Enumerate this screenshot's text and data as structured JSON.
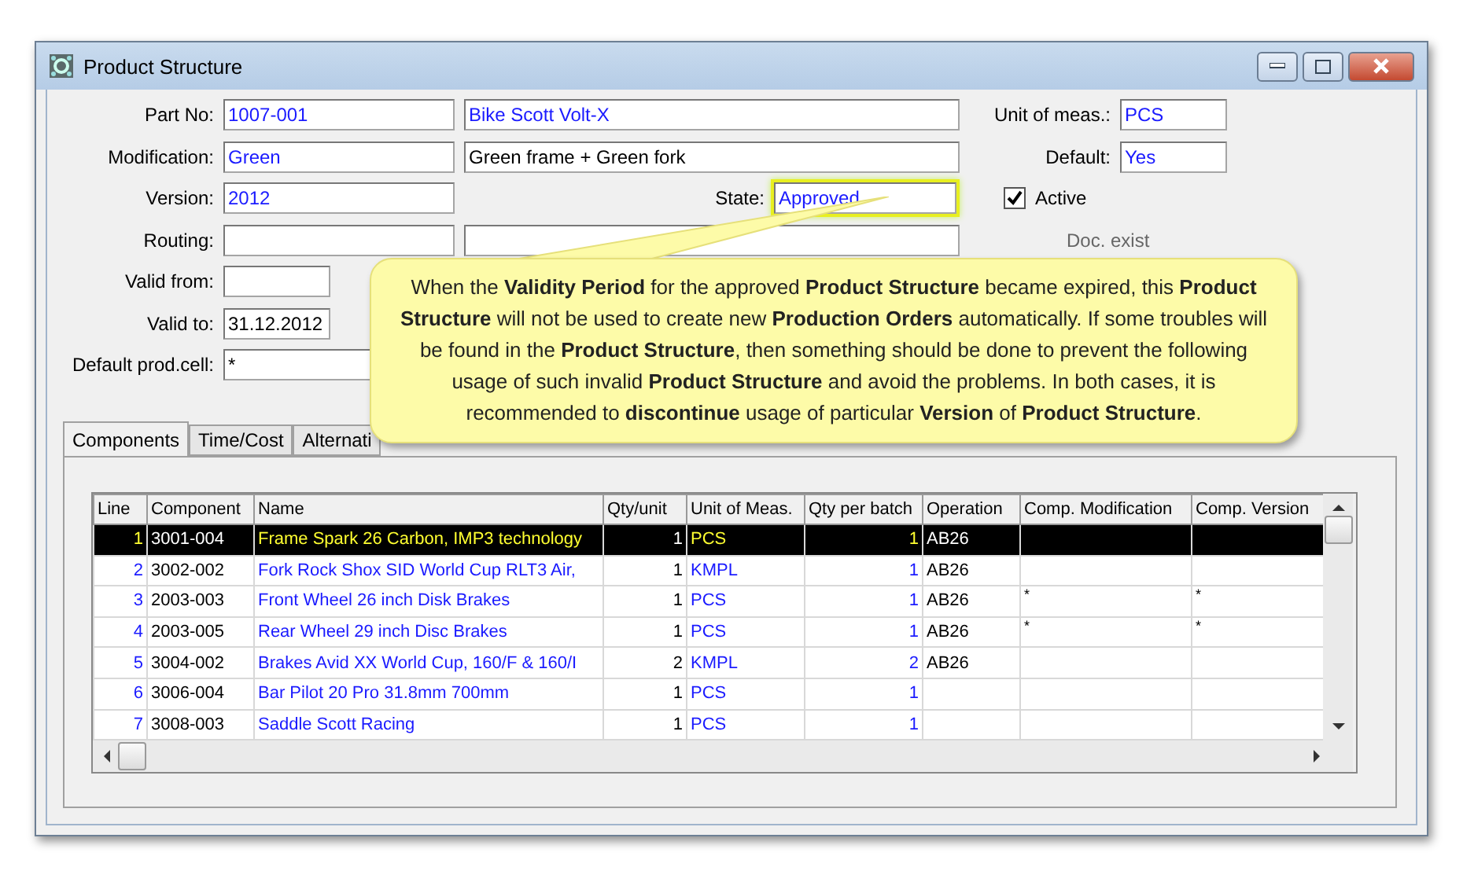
{
  "window": {
    "title": "Product Structure"
  },
  "form": {
    "part_no": {
      "label": "Part No:",
      "value": "1007-001",
      "description": "Bike Scott Volt-X"
    },
    "modification": {
      "label": "Modification:",
      "value": "Green",
      "description": "Green frame + Green fork"
    },
    "version": {
      "label": "Version:",
      "value": "2012"
    },
    "state": {
      "label": "State:",
      "value": "Approved",
      "highlighted": true
    },
    "routing": {
      "label": "Routing:"
    },
    "valid_from": {
      "label": "Valid from:"
    },
    "valid_to": {
      "label": "Valid to:",
      "value": "31.12.2012"
    },
    "default_prod_cell": {
      "label": "Default prod.cell:",
      "value": "*"
    },
    "unit_of_meas": {
      "label": "Unit of meas.:",
      "value": "PCS"
    },
    "default": {
      "label": "Default:",
      "value": "Yes"
    },
    "active": {
      "label": "Active",
      "checked": true
    },
    "doc_exist": {
      "label": "Doc. exist"
    }
  },
  "tabs": [
    {
      "label": "Components",
      "selected": true
    },
    {
      "label": "Time/Cost",
      "selected": false
    },
    {
      "label": "Alternati",
      "selected": false
    }
  ],
  "table": {
    "columns": [
      "Line",
      "Component",
      "Name",
      "Qty/unit",
      "Unit of Meas.",
      "Qty per batch",
      "Operation",
      "Comp. Modification",
      "Comp. Version"
    ],
    "rows": [
      {
        "selected": true,
        "cells": [
          "1",
          "3001-004",
          "Frame Spark 26 Carbon, IMP3 technology",
          "1",
          "PCS",
          "1",
          "AB26",
          "",
          ""
        ]
      },
      {
        "selected": false,
        "cells": [
          "2",
          "3002-002",
          "Fork Rock Shox SID World Cup RLT3 Air,",
          "1",
          "KMPL",
          "1",
          "AB26",
          "",
          ""
        ]
      },
      {
        "selected": false,
        "cells": [
          "3",
          "2003-003",
          "Front Wheel 26 inch Disk Brakes",
          "1",
          "PCS",
          "1",
          "AB26",
          "*",
          "*"
        ]
      },
      {
        "selected": false,
        "cells": [
          "4",
          "2003-005",
          "Rear Wheel 29 inch Disc Brakes",
          "1",
          "PCS",
          "1",
          "AB26",
          "*",
          "*"
        ]
      },
      {
        "selected": false,
        "cells": [
          "5",
          "3004-002",
          "Brakes Avid XX World Cup, 160/F & 160/I",
          "2",
          "KMPL",
          "2",
          "AB26",
          "",
          ""
        ]
      },
      {
        "selected": false,
        "cells": [
          "6",
          "3006-004",
          "Bar Pilot 20 Pro 31.8mm 700mm",
          "1",
          "PCS",
          "1",
          "",
          "",
          ""
        ]
      },
      {
        "selected": false,
        "cells": [
          "7",
          "3008-003",
          "Saddle Scott Racing",
          "1",
          "PCS",
          "1",
          "",
          "",
          ""
        ]
      }
    ]
  },
  "callout": {
    "text": "When the **Validity Period** for the approved **Product Structure** became expired, this **Product Structure** will not be used to create new **Production Orders** automatically. If some troubles will be found in the **Product Structure**, then something should be done to prevent the following usage of such invalid **Product Structure** and avoid the problems. In both cases, it is recommended to **discontinue** usage of particular **Version** of **Product Structure**."
  }
}
